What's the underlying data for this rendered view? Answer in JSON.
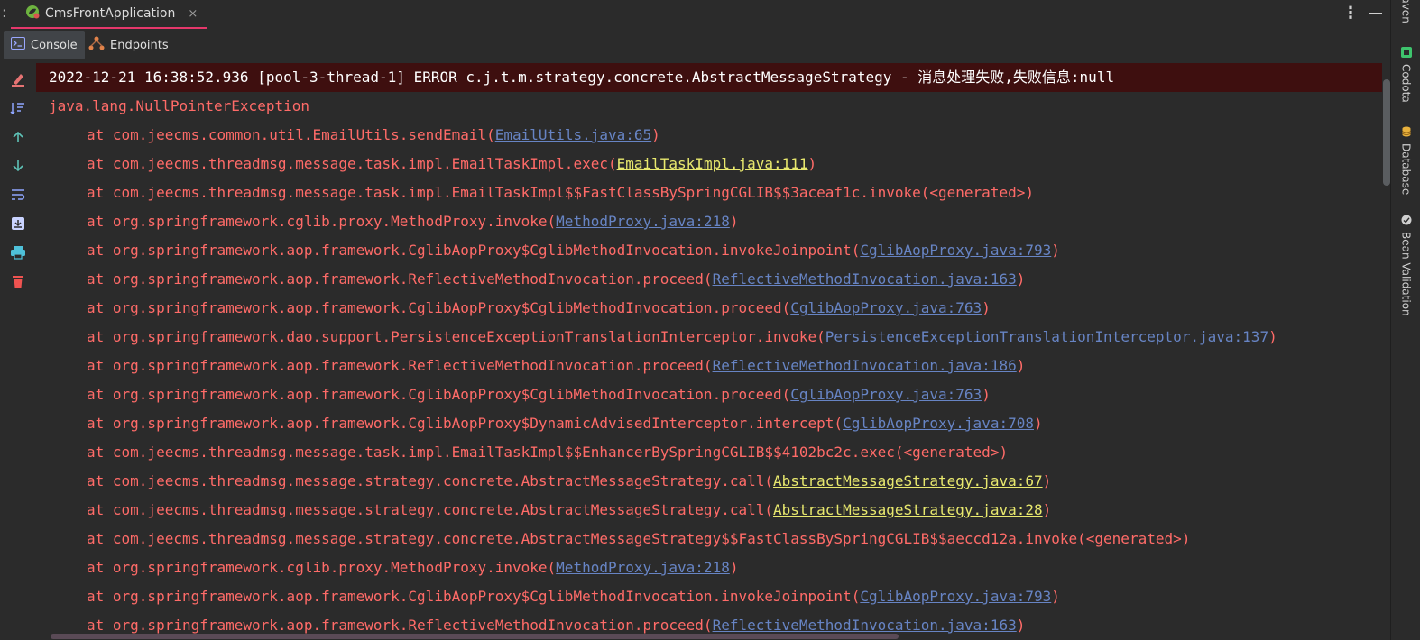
{
  "window": {
    "run_tab_title": "CmsFrontApplication",
    "close_glyph": "×",
    "left_dots": ":",
    "more_glyph": "⋮"
  },
  "subtabs": {
    "console_label": "Console",
    "endpoints_label": "Endpoints"
  },
  "right_strip": {
    "maven_label": "Maven",
    "codota_label": "Codota",
    "database_label": "Database",
    "bean_validation_label": "Bean Validation"
  },
  "colors": {
    "error_text": "#ff6b68",
    "link": "#6784c4",
    "local_link": "#e8e86e",
    "header_bg": "#3e0f0f",
    "accent": "#e5386b"
  },
  "console": {
    "header": "2022-12-21 16:38:52.936 [pool-3-thread-1] ERROR c.j.t.m.strategy.concrete.AbstractMessageStrategy - 消息处理失败,失败信息:null",
    "exception": "java.lang.NullPointerException",
    "frames": [
      {
        "prefix": "at com.jeecms.common.util.EmailUtils.sendEmail(",
        "link": "EmailUtils.java:65",
        "suffix": ")"
      },
      {
        "prefix": "at com.jeecms.threadmsg.message.task.impl.EmailTaskImpl.exec(",
        "link": "EmailTaskImpl.java:111",
        "suffix": ")"
      },
      {
        "prefix": "at com.jeecms.threadmsg.message.task.impl.EmailTaskImpl$$FastClassBySpringCGLIB$$3aceaf1c.invoke(<generated>)",
        "link": "",
        "suffix": ""
      },
      {
        "prefix": "at org.springframework.cglib.proxy.MethodProxy.invoke(",
        "link": "MethodProxy.java:218",
        "suffix": ")"
      },
      {
        "prefix": "at org.springframework.aop.framework.CglibAopProxy$CglibMethodInvocation.invokeJoinpoint(",
        "link": "CglibAopProxy.java:793",
        "suffix": ")"
      },
      {
        "prefix": "at org.springframework.aop.framework.ReflectiveMethodInvocation.proceed(",
        "link": "ReflectiveMethodInvocation.java:163",
        "suffix": ")"
      },
      {
        "prefix": "at org.springframework.aop.framework.CglibAopProxy$CglibMethodInvocation.proceed(",
        "link": "CglibAopProxy.java:763",
        "suffix": ")"
      },
      {
        "prefix": "at org.springframework.dao.support.PersistenceExceptionTranslationInterceptor.invoke(",
        "link": "PersistenceExceptionTranslationInterceptor.java:137",
        "suffix": ")"
      },
      {
        "prefix": "at org.springframework.aop.framework.ReflectiveMethodInvocation.proceed(",
        "link": "ReflectiveMethodInvocation.java:186",
        "suffix": ")"
      },
      {
        "prefix": "at org.springframework.aop.framework.CglibAopProxy$CglibMethodInvocation.proceed(",
        "link": "CglibAopProxy.java:763",
        "suffix": ")"
      },
      {
        "prefix": "at org.springframework.aop.framework.CglibAopProxy$DynamicAdvisedInterceptor.intercept(",
        "link": "CglibAopProxy.java:708",
        "suffix": ")"
      },
      {
        "prefix": "at com.jeecms.threadmsg.message.task.impl.EmailTaskImpl$$EnhancerBySpringCGLIB$$4102bc2c.exec(<generated>)",
        "link": "",
        "suffix": ""
      },
      {
        "prefix": "at com.jeecms.threadmsg.message.strategy.concrete.AbstractMessageStrategy.call(",
        "link": "AbstractMessageStrategy.java:67",
        "suffix": ")"
      },
      {
        "prefix": "at com.jeecms.threadmsg.message.strategy.concrete.AbstractMessageStrategy.call(",
        "link": "AbstractMessageStrategy.java:28",
        "suffix": ")"
      },
      {
        "prefix": "at com.jeecms.threadmsg.message.strategy.concrete.AbstractMessageStrategy$$FastClassBySpringCGLIB$$aeccd12a.invoke(<generated>)",
        "link": "",
        "suffix": ""
      },
      {
        "prefix": "at org.springframework.cglib.proxy.MethodProxy.invoke(",
        "link": "MethodProxy.java:218",
        "suffix": ")"
      },
      {
        "prefix": "at org.springframework.aop.framework.CglibAopProxy$CglibMethodInvocation.invokeJoinpoint(",
        "link": "CglibAopProxy.java:793",
        "suffix": ")"
      },
      {
        "prefix": "at org.springframework.aop.framework.ReflectiveMethodInvocation.proceed(",
        "link": "ReflectiveMethodInvocation.java:163",
        "suffix": ")"
      }
    ]
  }
}
